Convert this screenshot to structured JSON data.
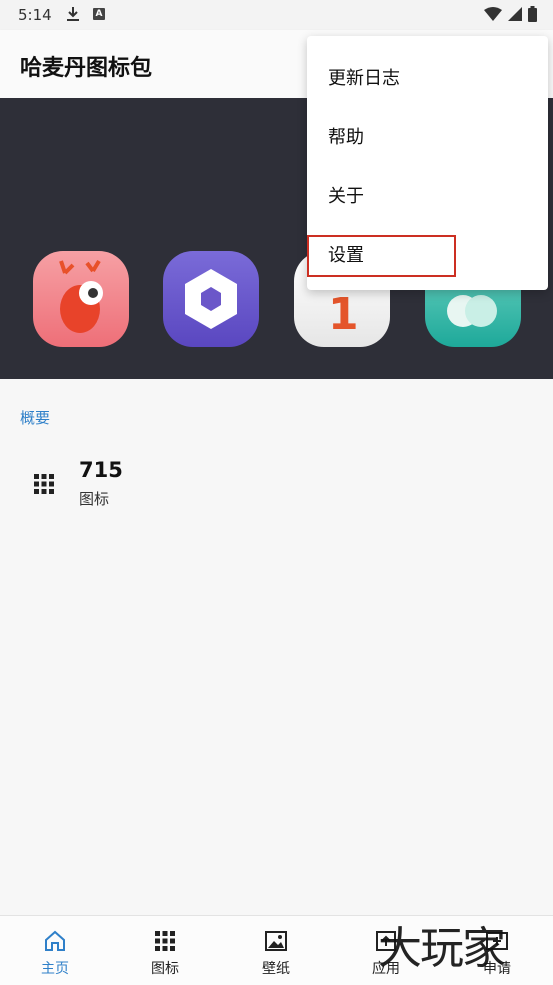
{
  "status_bar": {
    "time": "5:14",
    "a_badge": "A"
  },
  "app_bar": {
    "title": "哈麦丹图标包"
  },
  "banner": {
    "icons": [
      "deer-app-icon",
      "hexagon-app-icon",
      "calendar-app-icon",
      "green-app-icon"
    ],
    "calendar_number": "1"
  },
  "overview": {
    "section_label": "概要",
    "icon_count": "715",
    "icon_count_label": "图标"
  },
  "menu": {
    "items": [
      "更新日志",
      "帮助",
      "关于",
      "设置"
    ],
    "highlighted_item": "设置",
    "highlight_color": "#cc2f22"
  },
  "bottom_nav": {
    "items": [
      {
        "label": "主页",
        "icon": "home-icon",
        "active": true
      },
      {
        "label": "图标",
        "icon": "grid-icon",
        "active": false
      },
      {
        "label": "壁纸",
        "icon": "image-icon",
        "active": false
      },
      {
        "label": "应用",
        "icon": "apply-icon",
        "active": false
      },
      {
        "label": "申请",
        "icon": "request-icon",
        "active": false
      }
    ]
  },
  "accent_color": "#2f80c9",
  "watermark": "大玩家"
}
